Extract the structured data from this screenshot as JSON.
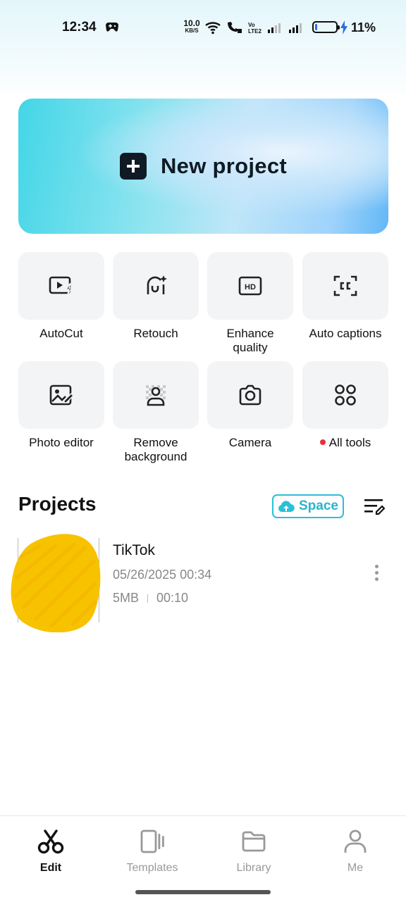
{
  "status_bar": {
    "time": "12:34",
    "net_speed_value": "10.0",
    "net_speed_unit": "KB/S",
    "battery_percent": "11%",
    "battery_level": 0.11
  },
  "hero": {
    "label": "New project"
  },
  "tools": [
    {
      "label": "AutoCut",
      "icon": "autocut-icon"
    },
    {
      "label": "Retouch",
      "icon": "retouch-icon"
    },
    {
      "label": "Enhance quality",
      "icon": "hd-icon"
    },
    {
      "label": "Auto captions",
      "icon": "captions-icon"
    },
    {
      "label": "Photo editor",
      "icon": "photo-editor-icon"
    },
    {
      "label": "Remove background",
      "icon": "remove-bg-icon"
    },
    {
      "label": "Camera",
      "icon": "camera-icon"
    },
    {
      "label": "All tools",
      "icon": "all-tools-icon"
    }
  ],
  "projects": {
    "title": "Projects",
    "space_label": "Space",
    "items": [
      {
        "name": "TikTok",
        "date": "05/26/2025 00:34",
        "size": "5MB",
        "duration": "00:10"
      }
    ]
  },
  "nav": {
    "items": [
      {
        "label": "Edit",
        "active": true
      },
      {
        "label": "Templates",
        "active": false
      },
      {
        "label": "Library",
        "active": false
      },
      {
        "label": "Me",
        "active": false
      }
    ]
  },
  "colors": {
    "accent": "#2bbfd7",
    "notification_dot": "#e8303a",
    "thumb": "#f7c200"
  }
}
